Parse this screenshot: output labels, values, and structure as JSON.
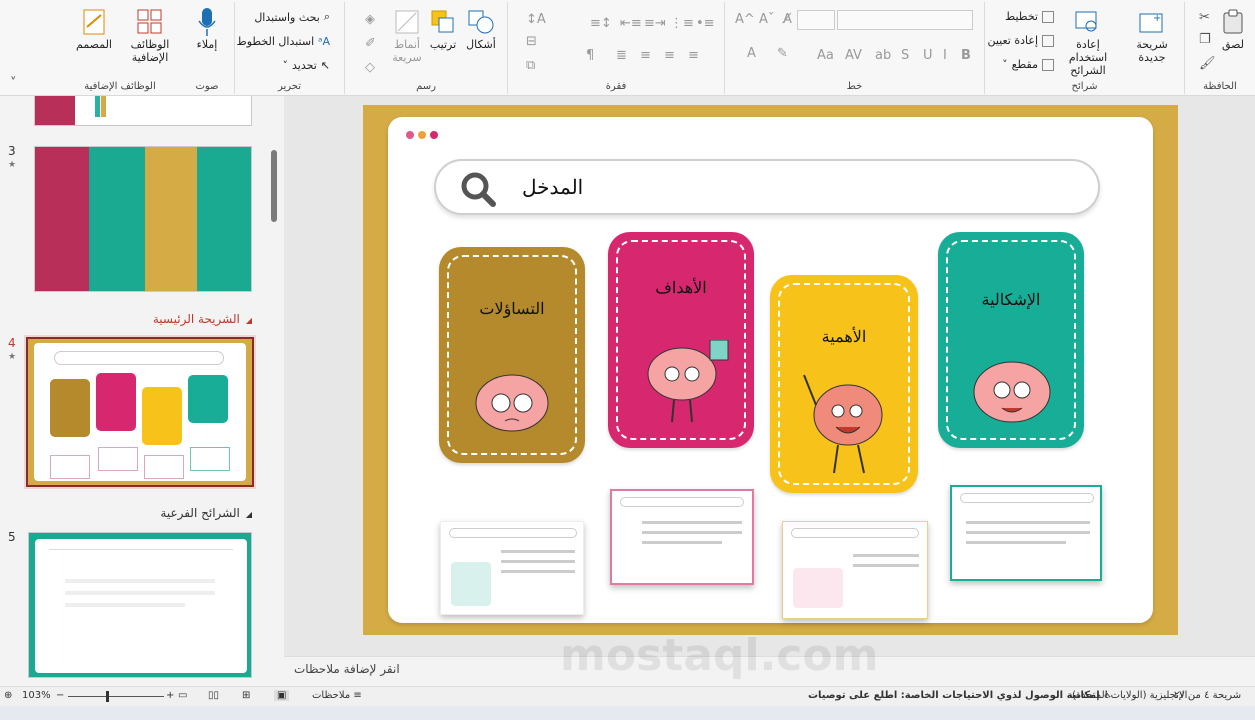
{
  "ribbon": {
    "groups": {
      "clipboard": "الحافظة",
      "slides": "شرائح",
      "font": "خط",
      "paragraph": "فقرة",
      "drawing": "رسم",
      "editing": "تحرير",
      "voice": "صوت",
      "addins": "الوظائف الإضافية"
    },
    "buttons": {
      "paste": "لصق",
      "new_slide": "شريحة جديدة",
      "reuse_slides": "إعادة استخدام الشرائح",
      "layout": "تخطيط",
      "reset": "إعادة تعيين",
      "section": "مقطع",
      "shapes": "أشكال",
      "arrange": "ترتيب",
      "quick_styles": "أنماط سريعة",
      "find": "بحث واستبدال",
      "replace_fonts": "استبدال الخطوط",
      "select": "تحديد",
      "dictate": "إملاء",
      "addins": "الوظائف الإضافية",
      "designer": "المصمم"
    }
  },
  "thumbnails": {
    "slide3_num": "3",
    "slide4_num": "4",
    "slide5_num": "5",
    "section_main": "الشريحة الرئيسية",
    "section_sub": "الشرائح الفرعية"
  },
  "slide": {
    "search_text": "المدخل",
    "cards": {
      "questions": "التساؤلات",
      "goals": "الأهداف",
      "importance": "الأهمية",
      "problem": "الإشكالية"
    }
  },
  "notes_placeholder": "انقر لإضافة ملاحظات",
  "status": {
    "slide_count": "شريحة ٤ من ٢٧",
    "language": "الإنجليزية (الولايات المتحدة)",
    "accessibility": "إمكانية الوصول لذوي الاحتياجات الخاصة: اطلع على توصيات",
    "notes": "ملاحظات",
    "zoom": "103%"
  },
  "watermark": "mostaql.com",
  "colors": {
    "mustard": "#b48a2c",
    "pink": "#d7286f",
    "yellow": "#f7c31b",
    "teal": "#18ad97",
    "slide_bg": "#d4ab45"
  }
}
